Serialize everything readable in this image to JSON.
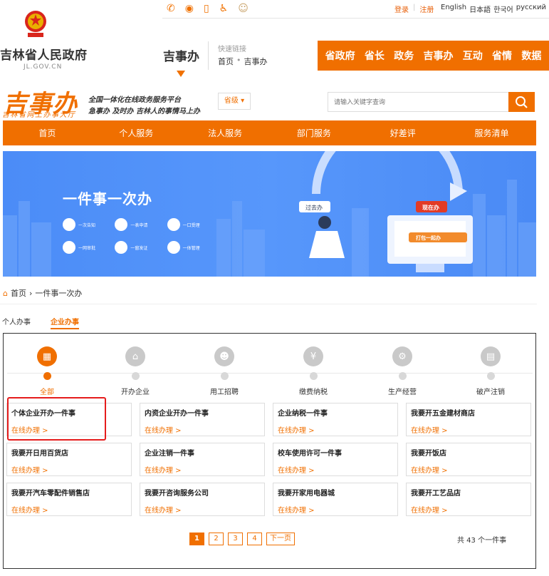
{
  "topbar": {
    "social_icons": [
      "wechat-icon",
      "weibo-icon",
      "mobile-icon",
      "accessibility-icon",
      "elderly-icon"
    ],
    "login": "登录",
    "register": "注册",
    "languages": [
      "English",
      "日本語",
      "한국어",
      "русский"
    ]
  },
  "header": {
    "gov_title": "吉林省人民政府",
    "gov_domain": "JL.GOV.CN",
    "site_name": "吉事办",
    "quick_label": "快速链接",
    "quick_home": "首页",
    "quick_current": "吉事办",
    "orange_nav": [
      "省政府",
      "省长",
      "政务",
      "吉事办",
      "互动",
      "省情",
      "数据"
    ]
  },
  "brand": {
    "logo": "吉事办",
    "logo_sub": "吉林省网上办事大厅",
    "slogan1": "全国一体化在线政务服务平台",
    "slogan2": "急事办 及时办 吉林人的事情马上办",
    "level": "省级",
    "search_placeholder": "请输入关键字查询"
  },
  "main_nav": [
    "首页",
    "个人服务",
    "法人服务",
    "部门服务",
    "好差评",
    "服务清单"
  ],
  "banner": {
    "title": "一件事一次办",
    "features": [
      "一次告知",
      "一表申请",
      "一口受理",
      "一网审批",
      "一窗发证",
      "一体管理"
    ],
    "past_label": "过去办",
    "now_label": "现在办",
    "pack_label": "打包一起办"
  },
  "breadcrumb": {
    "home": "首页",
    "current": "一件事一次办"
  },
  "tabs": {
    "personal": "个人办事",
    "enterprise": "企业办事"
  },
  "categories": [
    {
      "label": "全部",
      "icon": "grid-icon"
    },
    {
      "label": "开办企业",
      "icon": "shop-icon"
    },
    {
      "label": "用工招聘",
      "icon": "people-icon"
    },
    {
      "label": "缴费纳税",
      "icon": "tax-icon"
    },
    {
      "label": "生产经营",
      "icon": "gear-icon"
    },
    {
      "label": "破产注销",
      "icon": "document-icon"
    }
  ],
  "action_label": "在线办理 >",
  "items": [
    "个体企业开办一件事",
    "内资企业开办一件事",
    "企业纳税一件事",
    "我要开五金建材商店",
    "我要开日用百货店",
    "企业注销一件事",
    "校车使用许可一件事",
    "我要开饭店",
    "我要开汽车零配件销售店",
    "我要开咨询服务公司",
    "我要开家用电器城",
    "我要开工艺品店"
  ],
  "pager": {
    "pages": [
      "1",
      "2",
      "3",
      "4"
    ],
    "next": "下一页",
    "total": "共 43 个一件事"
  },
  "colors": {
    "brand_orange": "#f06f00",
    "banner_blue": "#4b8cf7",
    "highlight_red": "#e51c1c"
  }
}
